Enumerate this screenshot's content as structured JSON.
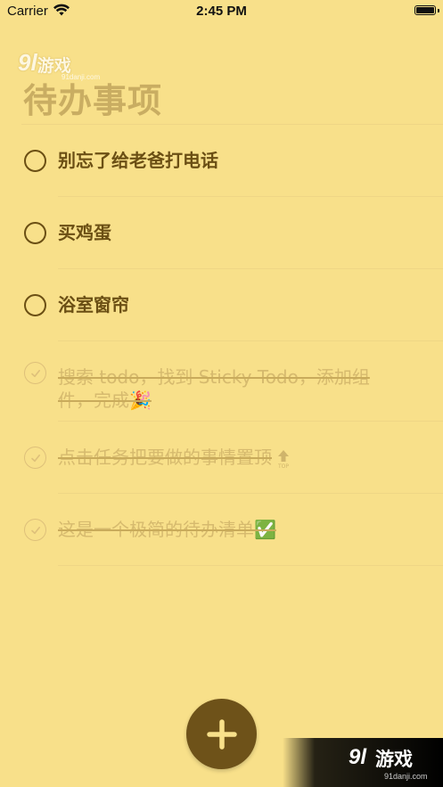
{
  "status_bar": {
    "carrier": "Carrier",
    "time": "2:45 PM"
  },
  "watermark": {
    "logo": "9l",
    "text": "游戏",
    "url": "91danji.com"
  },
  "page_title": "待办事项",
  "todos": [
    {
      "text": "别忘了给老爸打电话",
      "done": false
    },
    {
      "text": "买鸡蛋",
      "done": false
    },
    {
      "text": "浴室窗帘",
      "done": false
    },
    {
      "text": "搜索 todo，找到 Sticky Todo，添加组件，完成🎉",
      "done": true
    },
    {
      "text": "点击任务把要做的事情置顶",
      "done": true,
      "badge": "TOP"
    },
    {
      "text": "这是一个极简的待办清单✅",
      "done": true
    }
  ],
  "add_button_icon": "plus-icon",
  "colors": {
    "background": "#f8e08a",
    "accent": "#6e5219",
    "done_text": "#d6ba6e"
  }
}
